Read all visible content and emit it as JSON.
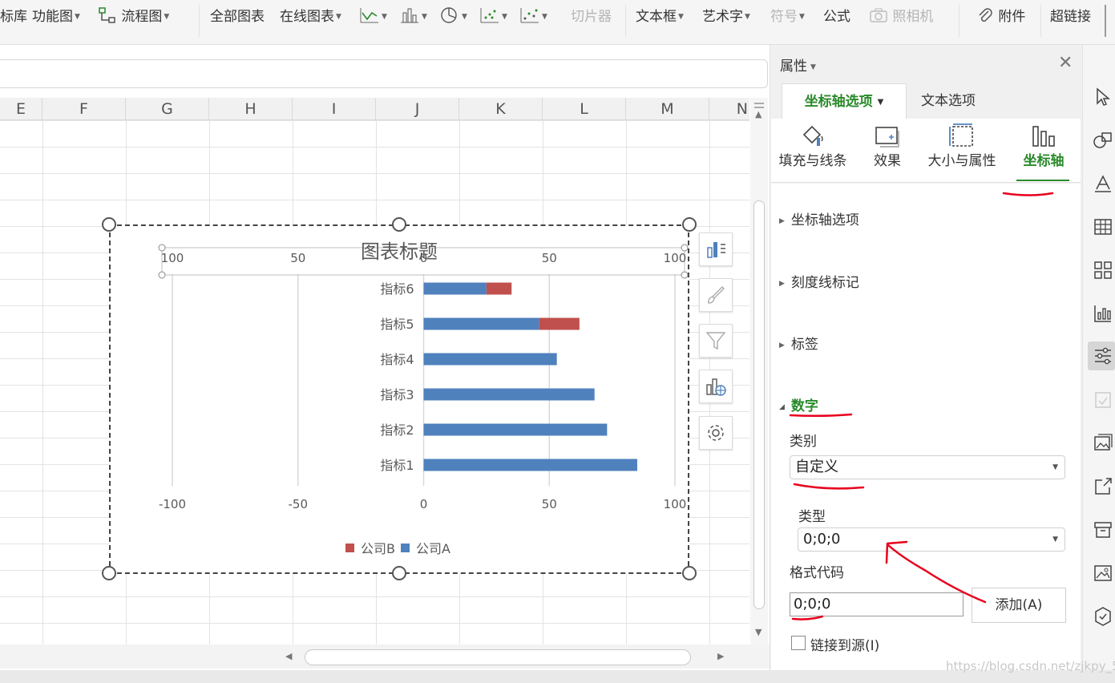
{
  "ribbon": {
    "items": [
      {
        "label": "标库",
        "caret": false,
        "disabled": false
      },
      {
        "label": "功能图",
        "caret": true,
        "disabled": false
      },
      {
        "label": "流程图",
        "caret": true,
        "disabled": false
      },
      {
        "label": "全部图表",
        "caret": false,
        "disabled": false
      },
      {
        "label": "在线图表",
        "caret": true,
        "disabled": false
      },
      {
        "label": "切片器",
        "caret": false,
        "disabled": true
      },
      {
        "label": "文本框",
        "caret": true,
        "disabled": false
      },
      {
        "label": "艺术字",
        "caret": true,
        "disabled": false
      },
      {
        "label": "符号",
        "caret": true,
        "disabled": true
      },
      {
        "label": "公式",
        "caret": false,
        "disabled": false
      },
      {
        "label": "照相机",
        "caret": false,
        "disabled": true
      },
      {
        "label": "附件",
        "caret": false,
        "disabled": false
      },
      {
        "label": "超链接",
        "caret": false,
        "disabled": false
      }
    ]
  },
  "sheet": {
    "columns": [
      "E",
      "F",
      "G",
      "H",
      "I",
      "J",
      "K",
      "L",
      "M",
      "N"
    ]
  },
  "chart_data": {
    "type": "bar",
    "title": "图表标题",
    "categories": [
      "指标1",
      "指标2",
      "指标3",
      "指标4",
      "指标5",
      "指标6"
    ],
    "series": [
      {
        "name": "公司A",
        "color": "#4f81bd",
        "values": [
          85,
          73,
          68,
          53,
          46,
          25
        ]
      },
      {
        "name": "公司B",
        "color": "#c0504d",
        "values": [
          0,
          0,
          0,
          0,
          16,
          10
        ]
      }
    ],
    "stacked": true,
    "primary_axis": {
      "min": -100,
      "max": 100,
      "ticks": [
        "-100",
        "-50",
        "0",
        "50",
        "100"
      ]
    },
    "secondary_axis": {
      "ticks": [
        "100",
        "50",
        "0",
        "50",
        "100"
      ]
    },
    "grid": true,
    "legend_position": "bottom"
  },
  "pane": {
    "title": "属性",
    "tabs": [
      {
        "label": "坐标轴选项"
      },
      {
        "label": "文本选项"
      }
    ],
    "subtabs": [
      {
        "label": "填充与线条",
        "icon": "fill-line-icon"
      },
      {
        "label": "效果",
        "icon": "effects-icon"
      },
      {
        "label": "大小与属性",
        "icon": "size-properties-icon"
      },
      {
        "label": "坐标轴",
        "icon": "axis-icon"
      }
    ],
    "sections": {
      "axis_options": "坐标轴选项",
      "tick_marks": "刻度线标记",
      "labels": "标签",
      "number": "数字"
    },
    "number": {
      "category_label": "类别",
      "category_value": "自定义",
      "type_label": "类型",
      "type_value": "0;0;0",
      "format_code_label": "格式代码",
      "format_code_value": "0;0;0",
      "add_button": "添加(A)",
      "link_source": "链接到源(I)"
    }
  },
  "watermark": "https://blog.csdn.net/zjkpy_5"
}
